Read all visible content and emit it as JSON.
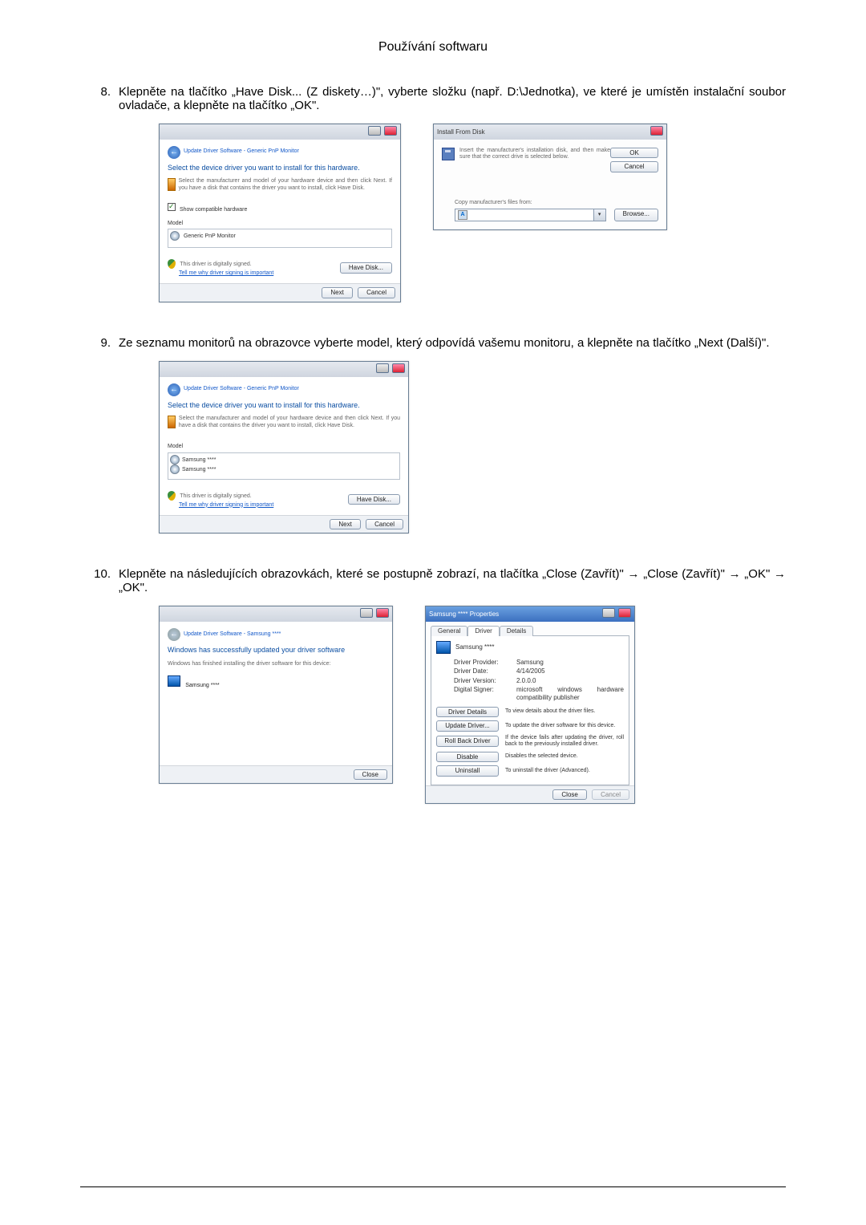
{
  "header": {
    "title": "Používání softwaru"
  },
  "steps": {
    "s8": {
      "num": "8.",
      "text": "Klepněte na tlačítko „Have Disk... (Z diskety…)\", vyberte složku (např. D:\\Jednotka), ve které je umístěn instalační soubor ovladače, a klepněte na tlačítko „OK\"."
    },
    "s9": {
      "num": "9.",
      "text": "Ze seznamu monitorů na obrazovce vyberte model, který odpovídá vašemu monitoru, a klepněte na tlačítko „Next (Další)\"."
    },
    "s10": {
      "num": "10.",
      "text": "Klepněte na následujících obrazovkách, které se postupně zobrazí, na tlačítka „Close (Zavřít)\" → „Close (Zavřít)\" → „OK\" → „OK\"."
    }
  },
  "dlg8a": {
    "breadcrumb": "Update Driver Software - Generic PnP Monitor",
    "headline": "Select the device driver you want to install for this hardware.",
    "note": "Select the manufacturer and model of your hardware device and then click Next. If you have a disk that contains the driver you want to install, click Have Disk.",
    "show_compat": "Show compatible hardware",
    "model_label": "Model",
    "model_item": "Generic PnP Monitor",
    "signed": "This driver is digitally signed.",
    "why_link": "Tell me why driver signing is important",
    "have_disk": "Have Disk...",
    "next": "Next",
    "cancel": "Cancel"
  },
  "dlg8b": {
    "title": "Install From Disk",
    "msg": "Insert the manufacturer's installation disk, and then make sure that the correct drive is selected below.",
    "ok": "OK",
    "cancel": "Cancel",
    "copy_label": "Copy manufacturer's files from:",
    "combo_value": "A:\\",
    "browse": "Browse..."
  },
  "dlg9": {
    "breadcrumb": "Update Driver Software - Generic PnP Monitor",
    "headline": "Select the device driver you want to install for this hardware.",
    "note": "Select the manufacturer and model of your hardware device and then click Next. If you have a disk that contains the driver you want to install, click Have Disk.",
    "model_label": "Model",
    "model_item1": "Samsung ****",
    "model_item2": "Samsung ****",
    "signed": "This driver is digitally signed.",
    "why_link": "Tell me why driver signing is important",
    "have_disk": "Have Disk...",
    "next": "Next",
    "cancel": "Cancel"
  },
  "dlg10a": {
    "breadcrumb": "Update Driver Software - Samsung ****",
    "headline": "Windows has successfully updated your driver software",
    "note": "Windows has finished installing the driver software for this device:",
    "device": "Samsung ****",
    "close": "Close"
  },
  "dlg10b": {
    "title": "Samsung **** Properties",
    "tabs": {
      "general": "General",
      "driver": "Driver",
      "details": "Details"
    },
    "device": "Samsung ****",
    "rows": {
      "provider_k": "Driver Provider:",
      "provider_v": "Samsung",
      "date_k": "Driver Date:",
      "date_v": "4/14/2005",
      "version_k": "Driver Version:",
      "version_v": "2.0.0.0",
      "signer_k": "Digital Signer:",
      "signer_v": "microsoft windows hardware compatibility publisher"
    },
    "buttons": {
      "details": "Driver Details",
      "details_d": "To view details about the driver files.",
      "update": "Update Driver...",
      "update_d": "To update the driver software for this device.",
      "rollback": "Roll Back Driver",
      "rollback_d": "If the device fails after updating the driver, roll back to the previously installed driver.",
      "disable": "Disable",
      "disable_d": "Disables the selected device.",
      "uninstall": "Uninstall",
      "uninstall_d": "To uninstall the driver (Advanced)."
    },
    "close": "Close",
    "cancel": "Cancel"
  }
}
